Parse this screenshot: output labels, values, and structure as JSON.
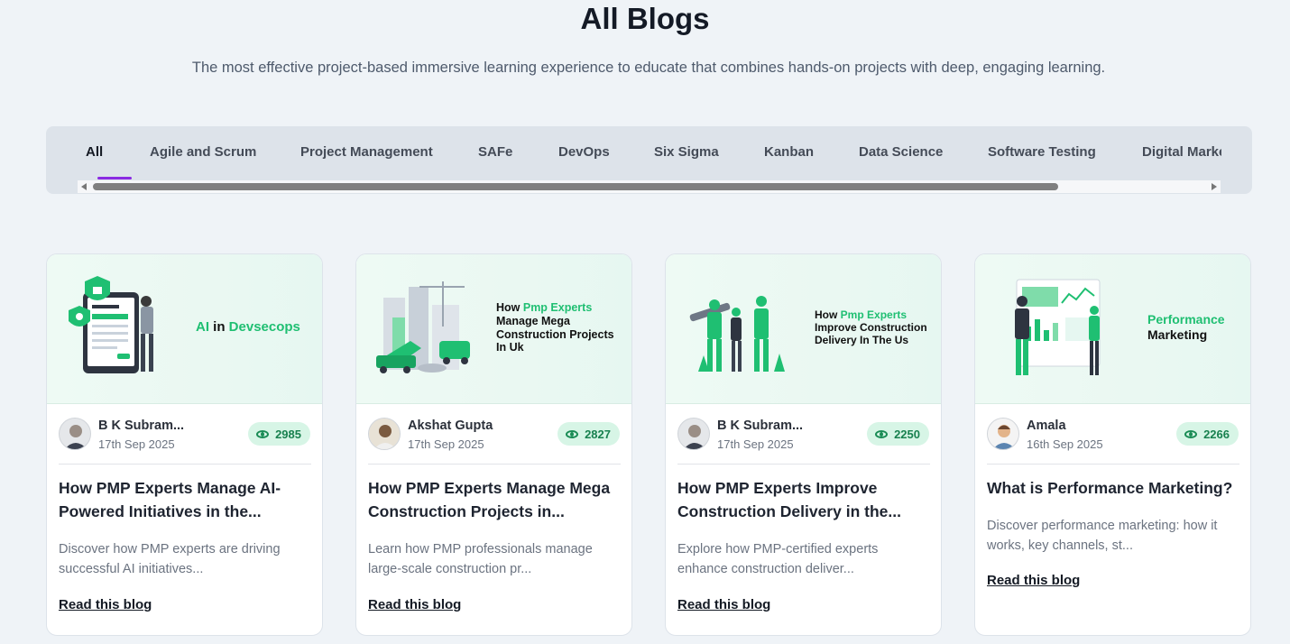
{
  "header": {
    "title": "All Blogs",
    "subtitle": "The most effective project-based immersive learning experience to educate that combines hands-on projects with deep, engaging learning."
  },
  "tabs": [
    {
      "label": "All",
      "active": true
    },
    {
      "label": "Agile and Scrum"
    },
    {
      "label": "Project Management"
    },
    {
      "label": "SAFe"
    },
    {
      "label": "DevOps"
    },
    {
      "label": "Six Sigma"
    },
    {
      "label": "Kanban"
    },
    {
      "label": "Data Science"
    },
    {
      "label": "Software Testing"
    },
    {
      "label": "Digital Marke"
    }
  ],
  "colors": {
    "accent_tab_underline": "#8a2be2",
    "badge_bg": "#d7f5e6",
    "badge_text": "#18814f",
    "image_green": "#1fbf72"
  },
  "cards": [
    {
      "image_text": {
        "g1": "AI",
        "t1": " in ",
        "g2": "Devsecops"
      },
      "author": "B K Subram...",
      "date": "17th Sep 2025",
      "views": "2985",
      "title": "How PMP Experts Manage AI-Powered Initiatives in the...",
      "description": "Discover how PMP experts are driving successful AI initiatives...",
      "link": "Read this blog"
    },
    {
      "image_text": {
        "t1": "How ",
        "g1": "Pmp Experts",
        "t2": "Manage Mega",
        "t3": "Construction Projects",
        "t4": "In Uk"
      },
      "author": "Akshat Gupta",
      "date": "17th Sep 2025",
      "views": "2827",
      "title": "How PMP Experts Manage Mega Construction Projects in...",
      "description": "Learn how PMP professionals manage large-scale construction pr...",
      "link": "Read this blog"
    },
    {
      "image_text": {
        "t1": "How ",
        "g1": "Pmp Experts",
        "t2": "Improve Construction",
        "t3": "Delivery In The Us"
      },
      "author": "B K Subram...",
      "date": "17th Sep 2025",
      "views": "2250",
      "title": "How PMP Experts Improve Construction Delivery in the...",
      "description": "Explore how PMP-certified experts enhance construction deliver...",
      "link": "Read this blog"
    },
    {
      "image_text": {
        "g1": "Performance",
        "t1": "Marketing"
      },
      "author": "Amala",
      "date": "16th Sep 2025",
      "views": "2266",
      "title": "What is Performance Marketing?",
      "description": "Discover performance marketing: how it works, key channels, st...",
      "link": "Read this blog"
    }
  ]
}
